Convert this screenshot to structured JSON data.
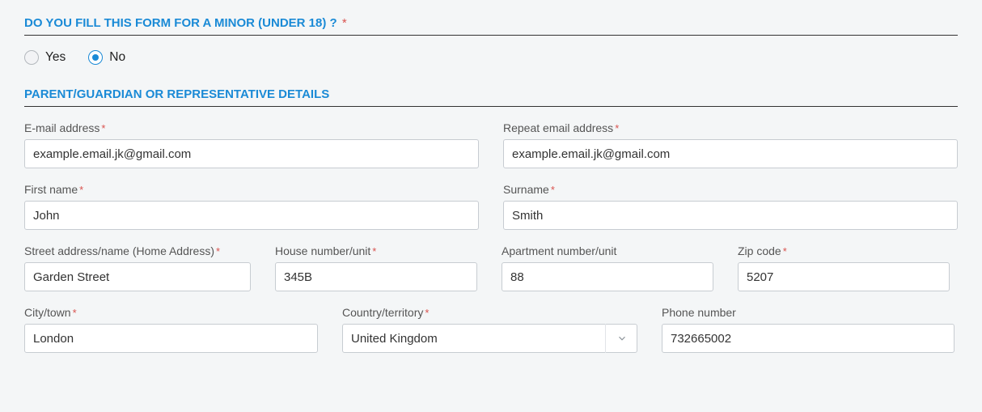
{
  "section1": {
    "title": "DO YOU FILL THIS FORM FOR A MINOR (UNDER 18) ?",
    "required_mark": "*"
  },
  "radio": {
    "yes_label": "Yes",
    "no_label": "No",
    "selected": "no"
  },
  "section2": {
    "title": "PARENT/GUARDIAN OR REPRESENTATIVE DETAILS"
  },
  "fields": {
    "email": {
      "label": "E-mail address",
      "required": "*",
      "value": "example.email.jk@gmail.com"
    },
    "email_repeat": {
      "label": "Repeat email address",
      "required": "*",
      "value": "example.email.jk@gmail.com"
    },
    "first_name": {
      "label": "First name",
      "required": "*",
      "value": "John"
    },
    "surname": {
      "label": "Surname",
      "required": "*",
      "value": "Smith"
    },
    "street": {
      "label": "Street address/name (Home Address)",
      "required": "*",
      "value": "Garden Street"
    },
    "house": {
      "label": "House number/unit",
      "required": "*",
      "value": "345B"
    },
    "apartment": {
      "label": "Apartment number/unit",
      "required": "",
      "value": "88"
    },
    "zip": {
      "label": "Zip code",
      "required": "*",
      "value": "5207"
    },
    "city": {
      "label": "City/town",
      "required": "*",
      "value": "London"
    },
    "country": {
      "label": "Country/territory",
      "required": "*",
      "value": "United Kingdom"
    },
    "phone": {
      "label": "Phone number",
      "required": "",
      "value": "732665002"
    }
  }
}
